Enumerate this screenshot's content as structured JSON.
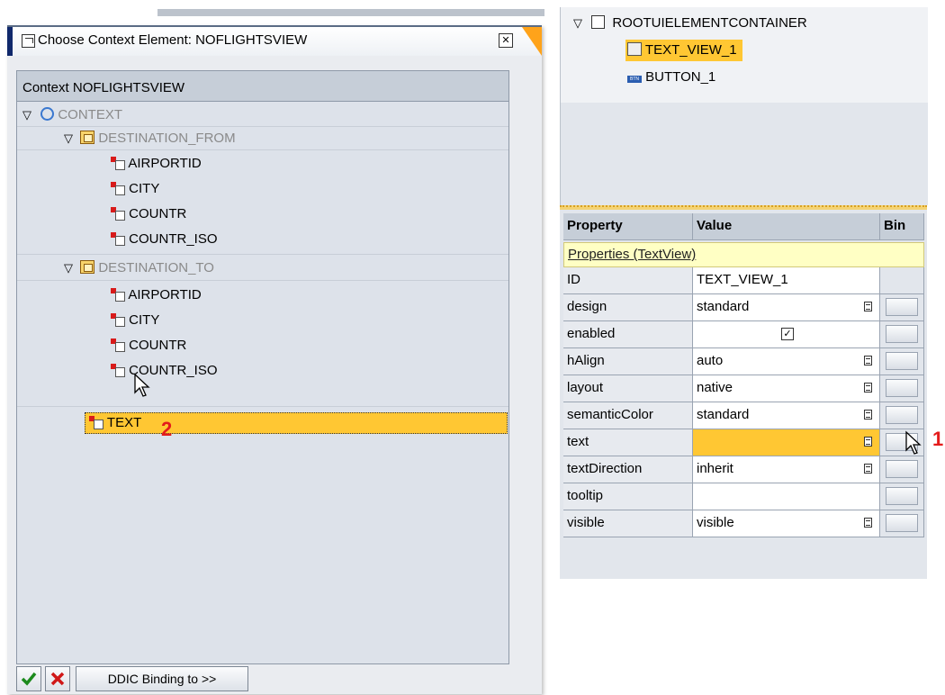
{
  "dialog": {
    "title": "Choose Context Element: NOFLIGHTSVIEW",
    "panel_header": "Context NOFLIGHTSVIEW",
    "tree": {
      "root": "CONTEXT",
      "nodes": [
        {
          "label": "DESTINATION_FROM",
          "attributes": [
            "AIRPORTID",
            "CITY",
            "COUNTR",
            "COUNTR_ISO"
          ]
        },
        {
          "label": "DESTINATION_TO",
          "attributes": [
            "AIRPORTID",
            "CITY",
            "COUNTR",
            "COUNTR_ISO"
          ]
        }
      ],
      "selected": "TEXT"
    },
    "footer": {
      "ok_icon": "check-icon",
      "cancel_icon": "cross-icon",
      "ddic_label": "DDIC Binding to >>"
    }
  },
  "markers": {
    "step1": "1",
    "step2": "2"
  },
  "hierarchy": {
    "root": "ROOTUIELEMENTCONTAINER",
    "items": [
      "TEXT_VIEW_1",
      "BUTTON_1"
    ]
  },
  "properties": {
    "headers": {
      "property": "Property",
      "value": "Value",
      "binding": "Bin"
    },
    "section": "Properties (TextView)",
    "rows": [
      {
        "name": "ID",
        "value": "TEXT_VIEW_1",
        "dropdown": false
      },
      {
        "name": "design",
        "value": "standard",
        "dropdown": true
      },
      {
        "name": "enabled",
        "value": "",
        "checkbox": true
      },
      {
        "name": "hAlign",
        "value": "auto",
        "dropdown": true
      },
      {
        "name": "layout",
        "value": "native",
        "dropdown": true
      },
      {
        "name": "semanticColor",
        "value": "standard",
        "dropdown": true
      },
      {
        "name": "text",
        "value": "",
        "dropdown": false
      },
      {
        "name": "textDirection",
        "value": "inherit",
        "dropdown": true
      },
      {
        "name": "tooltip",
        "value": "",
        "dropdown": false
      },
      {
        "name": "visible",
        "value": "visible",
        "dropdown": true
      }
    ]
  },
  "colors": {
    "selection": "#ffc733",
    "accent": "#ffa31a",
    "title_accent": "#10286b"
  }
}
